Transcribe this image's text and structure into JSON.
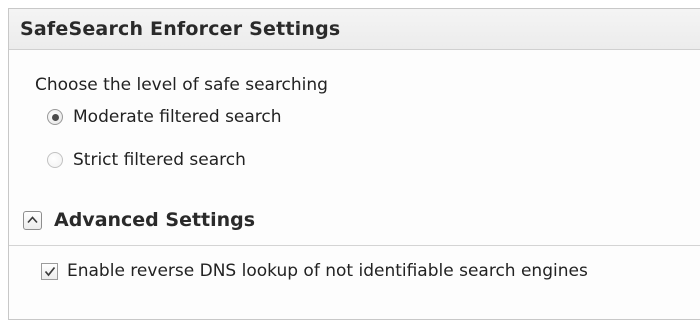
{
  "header": {
    "title": "SafeSearch Enforcer Settings"
  },
  "level": {
    "prompt": "Choose the level of safe searching",
    "options": [
      {
        "label": "Moderate filtered search",
        "selected": true
      },
      {
        "label": "Strict filtered search",
        "selected": false
      }
    ]
  },
  "advanced": {
    "title": "Advanced Settings",
    "expanded": true,
    "toggle_icon": "chevron-up-icon",
    "reverse_dns": {
      "label": "Enable reverse DNS lookup of not identifiable search engines",
      "checked": true,
      "check_icon": "checkmark-icon"
    }
  }
}
